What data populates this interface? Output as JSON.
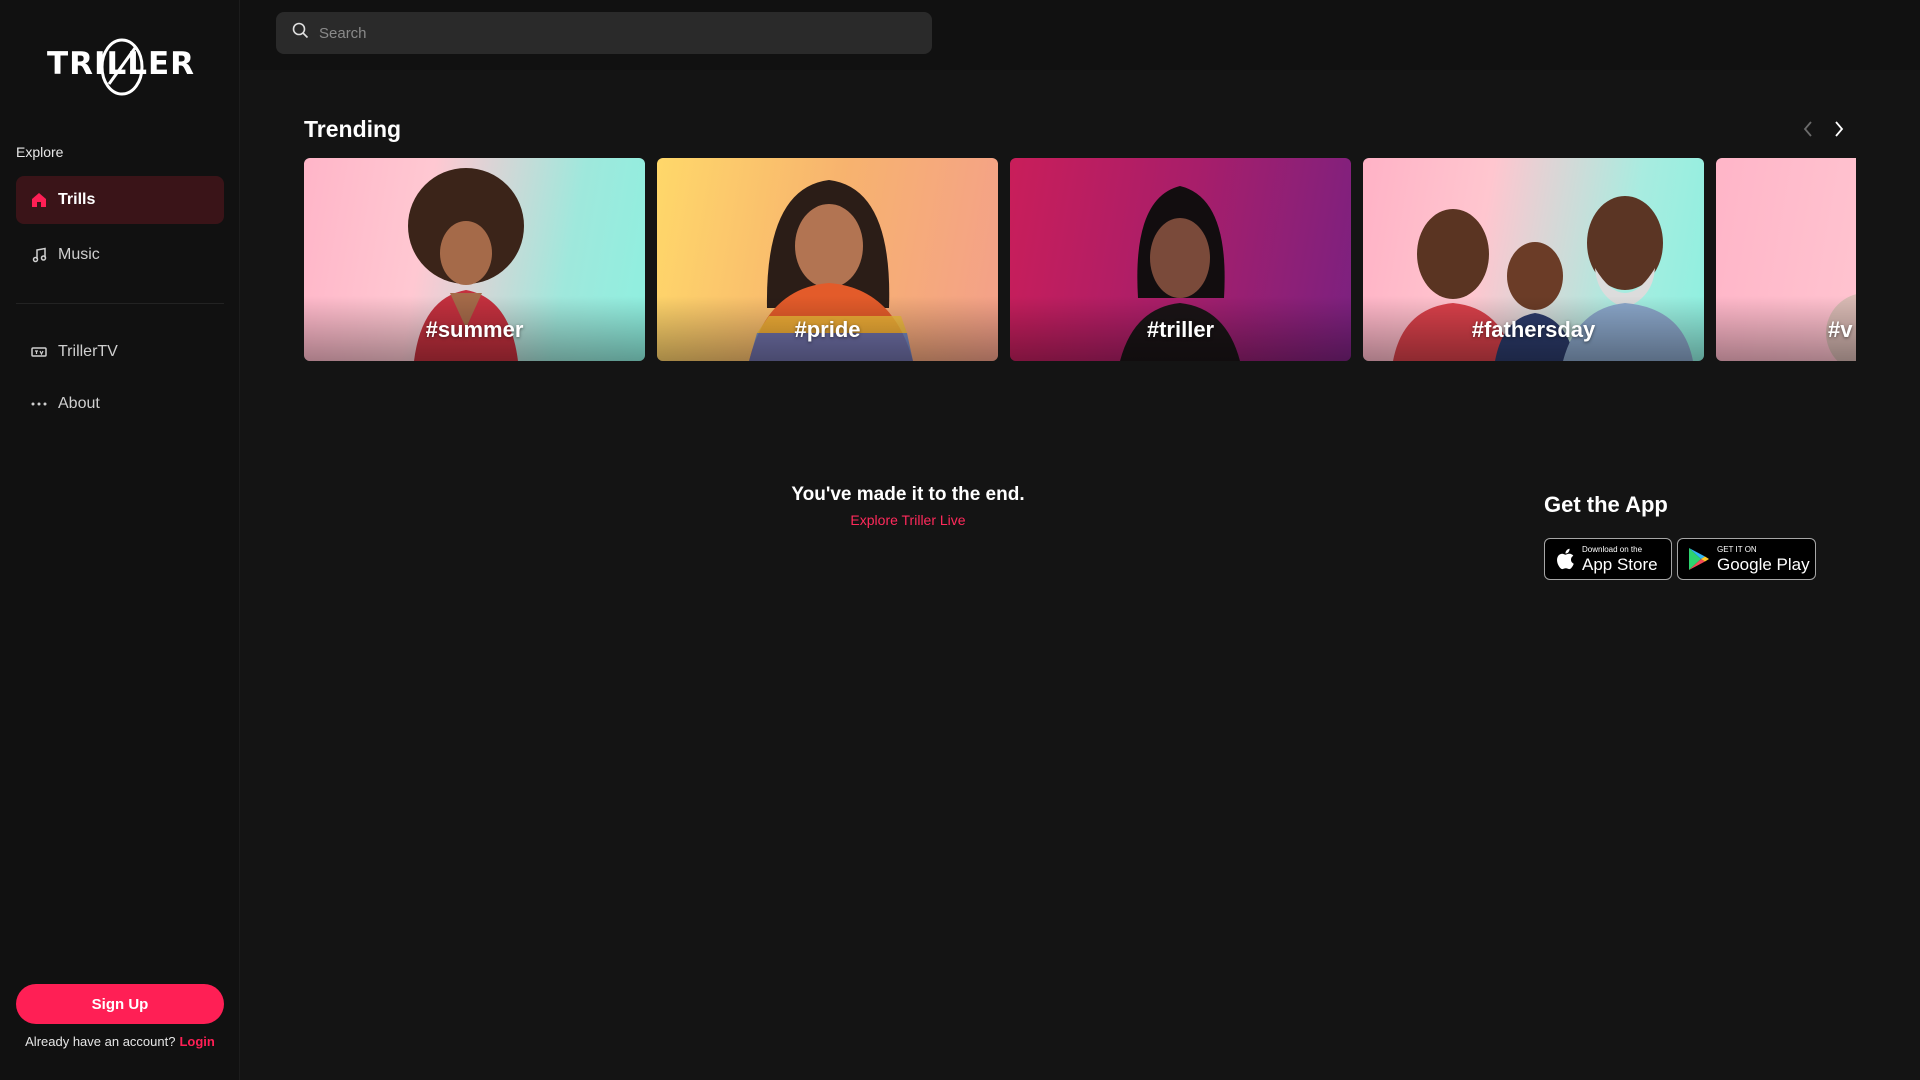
{
  "brand": {
    "logo_text": "TRILLER"
  },
  "sidebar": {
    "section_label": "Explore",
    "items": [
      {
        "label": "Trills",
        "icon": "home-icon",
        "active": true
      },
      {
        "label": "Music",
        "icon": "music-note-icon",
        "active": false
      },
      {
        "label": "TrillerTV",
        "icon": "tv-icon",
        "active": false
      },
      {
        "label": "About",
        "icon": "more-dots-icon",
        "active": false
      }
    ],
    "signup_label": "Sign Up",
    "account_prompt": "Already have an account?",
    "login_label": "Login"
  },
  "search": {
    "placeholder": "Search"
  },
  "trending": {
    "title": "Trending",
    "cards": [
      {
        "tag": "#summer"
      },
      {
        "tag": "#pride"
      },
      {
        "tag": "#triller"
      },
      {
        "tag": "#fathersday"
      },
      {
        "tag": "#v"
      }
    ]
  },
  "end": {
    "message": "You've made it to the end.",
    "link": "Explore Triller Live"
  },
  "app": {
    "title": "Get the App",
    "apple_small": "Download on the",
    "apple_big": "App Store",
    "google_small": "GET IT ON",
    "google_big": "Google Play"
  },
  "colors": {
    "accent": "#ff1f55",
    "background": "#141414",
    "sidebar": "#111111",
    "active_item": "#3a1418"
  }
}
